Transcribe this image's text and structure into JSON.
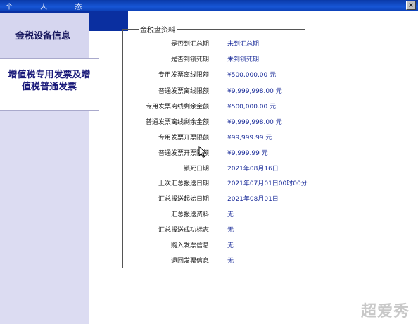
{
  "window": {
    "title": "个 人 态",
    "close_label": "x"
  },
  "nav": {
    "item1": "金税设备信息",
    "item2_line1": "增值税专用发票及增",
    "item2_line2": "值税普通发票"
  },
  "panel": {
    "legend": "金税盘资料",
    "rows": [
      {
        "label": "是否到汇总期",
        "value": "未到汇总期"
      },
      {
        "label": "是否到锁死期",
        "value": "未到锁死期"
      },
      {
        "label": "专用发票离线限额",
        "value": "¥500,000.00 元"
      },
      {
        "label": "普通发票离线限额",
        "value": "¥9,999,998.00 元"
      },
      {
        "label": "专用发票离线剩余金额",
        "value": "¥500,000.00 元"
      },
      {
        "label": "普通发票离线剩余金额",
        "value": "¥9,999,998.00 元"
      },
      {
        "label": "专用发票开票限额",
        "value": "¥99,999.99 元"
      },
      {
        "label": "普通发票开票限额",
        "value": "¥9,999.99 元"
      },
      {
        "label": "锁死日期",
        "value": "2021年08月16日"
      },
      {
        "label": "上次汇总报送日期",
        "value": "2021年07月01日00时00分"
      },
      {
        "label": "汇总报送起始日期",
        "value": "2021年08月01日"
      },
      {
        "label": "汇总报送资料",
        "value": "无"
      },
      {
        "label": "汇总报送成功标志",
        "value": "无"
      },
      {
        "label": "购入发票信息",
        "value": "无"
      },
      {
        "label": "退回发票信息",
        "value": "无"
      }
    ]
  },
  "watermark": "超爱秀"
}
